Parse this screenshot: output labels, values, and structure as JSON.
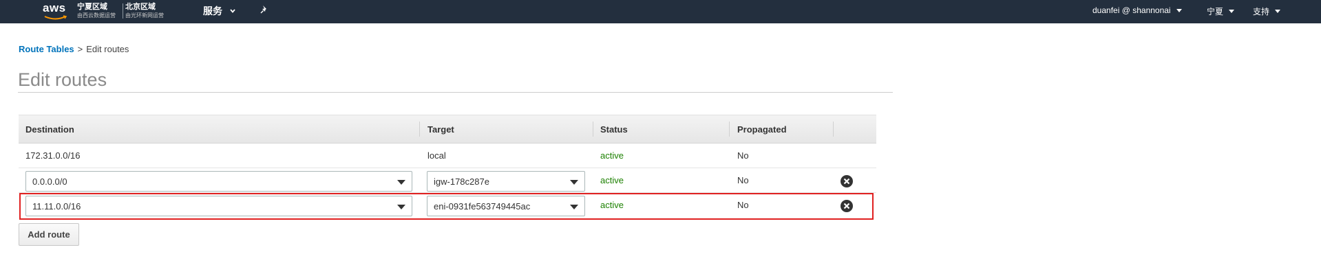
{
  "nav": {
    "logo": "aws",
    "region1": {
      "title": "宁夏区域",
      "subtitle": "由西云数据运营"
    },
    "region2": {
      "title": "北京区域",
      "subtitle": "由光环新网运营"
    },
    "services": "服务",
    "user": "duanfei @ shannonai",
    "region_menu": "宁夏",
    "support": "支持"
  },
  "breadcrumb": {
    "link": "Route Tables",
    "separator": ">",
    "current": "Edit routes"
  },
  "page_title": "Edit routes",
  "table": {
    "headers": [
      "Destination",
      "Target",
      "Status",
      "Propagated"
    ],
    "rows": [
      {
        "destination": "172.31.0.0/16",
        "target": "local",
        "status": "active",
        "propagated": "No"
      },
      {
        "destination": "0.0.0.0/0",
        "target": "igw-178c287e",
        "status": "active",
        "propagated": "No"
      },
      {
        "destination": "11.11.0.0/16",
        "target": "eni-0931fe563749445ac",
        "status": "active",
        "propagated": "No"
      }
    ]
  },
  "add_route_label": "Add route",
  "colors": {
    "nav_bg": "#232f3e",
    "link": "#0073bb",
    "active": "#1d8102",
    "highlight": "#e02020"
  }
}
